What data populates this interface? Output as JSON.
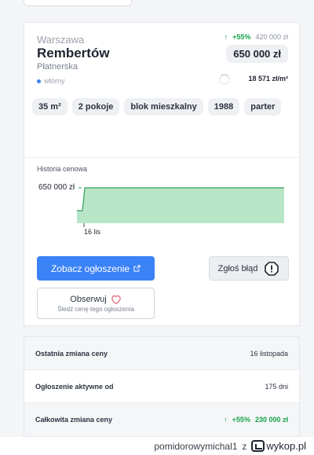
{
  "listing": {
    "city": "Warszawa",
    "district": "Rembertów",
    "street": "Płatnerska",
    "market": "wtórny",
    "price_change_pct": "+55%",
    "price_change_amount": "420 000 zł",
    "price": "650 000 zł",
    "price_per_m2": "18 571 zł/m²",
    "tags": [
      "35 m²",
      "2 pokoje",
      "blok mieszkalny",
      "1988",
      "parter"
    ]
  },
  "history": {
    "title": "Historia cenowa",
    "y_tick": "650 000 zł",
    "x_tick": "16 lis"
  },
  "chart_data": {
    "type": "area",
    "title": "Historia cenowa",
    "x_ticks": [
      "16 lis"
    ],
    "y_ticks": [
      "650 000 zł"
    ],
    "series": [
      {
        "points": [
          {
            "x": "before 16 lis",
            "y": 420000
          },
          {
            "x": "16 lis",
            "y": 650000
          },
          {
            "x": "latest",
            "y": 650000
          }
        ]
      }
    ],
    "colors": {
      "fill": "#9fd9b2",
      "line": "#2f9e5d"
    }
  },
  "actions": {
    "open_listing": "Zobacz ogłoszenie",
    "report_error": "Zgłoś błąd",
    "follow": "Obserwuj",
    "follow_sub": "Śledź cenę tego ogłoszenia"
  },
  "info": [
    {
      "label": "Ostatnia zmiana ceny",
      "value": "16 listopada"
    },
    {
      "label": "Ogłoszenie aktywne od",
      "value": "175 dni"
    }
  ],
  "total_change": {
    "label": "Całkowita zmiana ceny",
    "pct": "+55%",
    "amount": "230 000 zł"
  },
  "footer": {
    "user": "pomidorowymichal1",
    "source_prefix": "z",
    "site": "wykop.pl"
  },
  "colors": {
    "accent": "#3b82f6",
    "up": "#16a34a"
  }
}
